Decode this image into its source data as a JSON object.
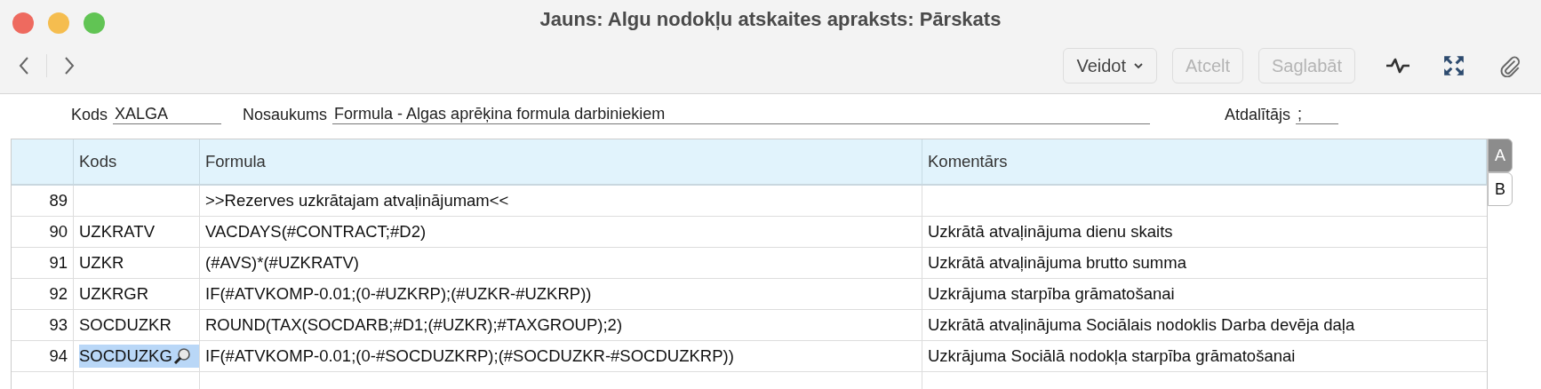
{
  "window": {
    "title": "Jauns: Algu nodokļu atskaites apraksts: Pārskats"
  },
  "toolbar": {
    "buttons": [
      {
        "label": "Veidot",
        "kind": "menu",
        "disabled": false
      },
      {
        "label": "Atcelt",
        "kind": "plain",
        "disabled": true
      },
      {
        "label": "Saglabāt",
        "kind": "plain",
        "disabled": true
      }
    ]
  },
  "fields": [
    {
      "label": "Kods",
      "value": "XALGA",
      "kind": "short"
    },
    {
      "label": "Nosaukums",
      "value": "Formula - Algas aprēķina formula darbiniekiem",
      "kind": "wide"
    },
    {
      "label": "Atdalītājs",
      "value": ";",
      "kind": "tiny"
    }
  ],
  "table": {
    "columns": [
      "Kods",
      "Formula",
      "Komentārs"
    ],
    "rows": [
      {
        "number": "89",
        "code": "",
        "formula": ">>Rezerves uzkrātajam atvaļinājumam<<",
        "comment": "",
        "selected": false
      },
      {
        "number": "90",
        "code": "UZKRATV",
        "formula": "VACDAYS(#CONTRACT;#D2)",
        "comment": "Uzkrātā atvaļinājuma dienu skaits",
        "selected": false
      },
      {
        "number": "91",
        "code": "UZKR",
        "formula": "(#AVS)*(#UZKRATV)",
        "comment": "Uzkrātā atvaļinājuma  brutto summa",
        "selected": false
      },
      {
        "number": "92",
        "code": "UZKRGR",
        "formula": "IF(#ATVKOMP-0.01;(0-#UZKRP);(#UZKR-#UZKRP))",
        "comment": "Uzkrājuma starpība grāmatošanai",
        "selected": false
      },
      {
        "number": "93",
        "code": "SOCDUZKR",
        "formula": "ROUND(TAX(SOCDARB;#D1;(#UZKR);#TAXGROUP);2)",
        "comment": "Uzkrātā atvaļinājuma Sociālais nodoklis Darba devēja daļa",
        "selected": false
      },
      {
        "number": "94",
        "code": "SOCDUZKG",
        "formula": "IF(#ATVKOMP-0.01;(0-#SOCDUZKRP);(#SOCDUZKR-#SOCDUZKRP))",
        "comment": "Uzkrājuma Sociālā nodokļa starpība grāmatošanai",
        "selected": true
      }
    ]
  },
  "side_tabs": [
    {
      "label": "A",
      "selected": true
    },
    {
      "label": "B",
      "selected": false
    }
  ]
}
